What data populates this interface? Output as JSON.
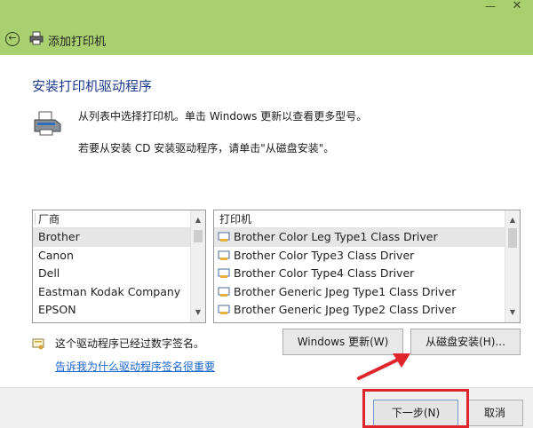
{
  "window": {
    "title": "添加打印机",
    "minimize_glyph": "—",
    "close_glyph": "✕",
    "back_glyph": "←"
  },
  "content": {
    "heading": "安装打印机驱动程序",
    "instruction_list": "从列表中选择打印机。单击 Windows 更新以查看更多型号。",
    "instruction_disk": "若要从安装 CD 安装驱动程序，请单击\"从磁盘安装\"。"
  },
  "manufacturer_list": {
    "header": "厂商",
    "items": [
      "Brother",
      "Canon",
      "Dell",
      "Eastman Kodak Company",
      "EPSON"
    ],
    "selected": "Brother"
  },
  "printer_list": {
    "header": "打印机",
    "items": [
      "Brother Color Leg Type1 Class Driver",
      "Brother Color Type3 Class Driver",
      "Brother Color Type4 Class Driver",
      "Brother Generic Jpeg Type1 Class Driver",
      "Brother Generic Jpeg Type2 Class Driver"
    ],
    "selected": "Brother Color Leg Type1 Class Driver"
  },
  "signature": {
    "text": "这个驱动程序已经过数字签名。",
    "link": "告诉我为什么驱动程序签名很重要"
  },
  "buttons": {
    "windows_update": "Windows 更新(W)",
    "have_disk": "从磁盘安装(H)...",
    "next": "下一步(N)",
    "cancel": "取消"
  },
  "colors": {
    "titlebar": "#a9d06e",
    "heading": "#1e3a8a",
    "link": "#1a66cc",
    "highlight": "#e0242b"
  }
}
